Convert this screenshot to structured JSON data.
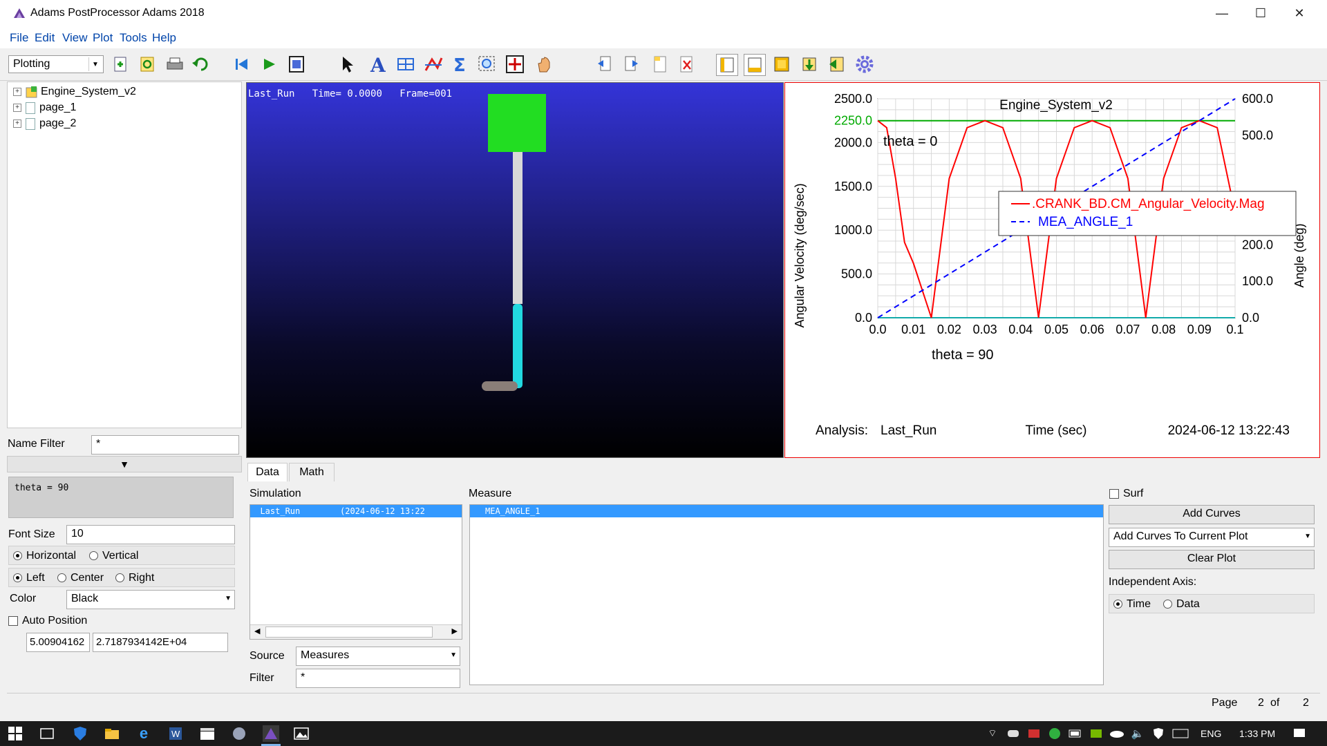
{
  "window": {
    "title": "Adams PostProcessor Adams 2018",
    "minimize": "—",
    "maximize": "☐",
    "close": "✕"
  },
  "menu": [
    "File",
    "Edit",
    "View",
    "Plot",
    "Tools",
    "Help"
  ],
  "toolbar": {
    "mode": "Plotting"
  },
  "tree": [
    {
      "label": "Engine_System_v2",
      "icon": "model-icon"
    },
    {
      "label": "page_1",
      "icon": "page-icon"
    },
    {
      "label": "page_2",
      "icon": "page-icon"
    }
  ],
  "left": {
    "name_filter_label": "Name Filter",
    "name_filter_value": "*",
    "text_content": "theta = 90",
    "font_size_label": "Font Size",
    "font_size_value": "10",
    "orient_horizontal": "Horizontal",
    "orient_vertical": "Vertical",
    "align_left": "Left",
    "align_center": "Center",
    "align_right": "Right",
    "color_label": "Color",
    "color_value": "Black",
    "auto_position_label": "Auto Position",
    "pos_x": "5.00904162",
    "pos_y": "2.7187934142E+04"
  },
  "viewport": {
    "run": "Last_Run",
    "time_label": "Time=",
    "time": "0.0000",
    "frame_label": "Frame=001"
  },
  "chart_data": {
    "type": "line",
    "title": "Engine_System_v2",
    "xlabel": "Time (sec)",
    "ylabel": "Angular Velocity (deg/sec)",
    "y2label": "Angle (deg)",
    "xlim": [
      0.0,
      0.1
    ],
    "ylim": [
      0.0,
      2500.0
    ],
    "y2lim": [
      0.0,
      600.0
    ],
    "x_ticks": [
      "0.0",
      "0.01",
      "0.02",
      "0.03",
      "0.04",
      "0.05",
      "0.06",
      "0.07",
      "0.08",
      "0.09",
      "0.1"
    ],
    "y_ticks": [
      "0.0",
      "500.0",
      "1000.0",
      "1500.0",
      "2000.0",
      "2500.0"
    ],
    "y2_ticks": [
      "0.0",
      "100.0",
      "200.0",
      "300.0",
      "400.0",
      "500.0",
      "600.0"
    ],
    "grid": true,
    "series": [
      {
        "name": ".CRANK_BD.CM_Angular_Velocity.Mag",
        "color": "#ff0000",
        "style": "solid",
        "axis": "left",
        "x": [
          0.0,
          0.0025,
          0.005,
          0.0075,
          0.01,
          0.015,
          0.02,
          0.025,
          0.03,
          0.035,
          0.04,
          0.045,
          0.05,
          0.055,
          0.06,
          0.065,
          0.07,
          0.075,
          0.08,
          0.085,
          0.09,
          0.095,
          0.1
        ],
        "values": [
          2250,
          2170,
          1590,
          860,
          620,
          0,
          1590,
          2170,
          2250,
          2170,
          1590,
          0,
          1590,
          2170,
          2250,
          2170,
          1590,
          0,
          1590,
          2170,
          2250,
          2170,
          1200
        ]
      },
      {
        "name": "MEA_ANGLE_1",
        "color": "#0000ff",
        "style": "dashed",
        "axis": "right",
        "x": [
          0.0,
          0.1
        ],
        "values": [
          0.0,
          600.0
        ]
      }
    ],
    "hline": {
      "value": 2250.0,
      "label": "2250.0",
      "color": "#00aa00"
    },
    "annotations": [
      "theta = 0",
      "theta = 90"
    ],
    "legend_position": "top-right",
    "footer": {
      "analysis_label": "Analysis:",
      "analysis": "Last_Run",
      "timestamp": "2024-06-12 13:22:43"
    }
  },
  "lower": {
    "tabs": [
      "Data",
      "Math"
    ],
    "simulation_label": "Simulation",
    "simulation_items": [
      {
        "name": "Last_Run",
        "date": "(2024-06-12 13:22"
      }
    ],
    "measure_label": "Measure",
    "measure_items": [
      "MEA_ANGLE_1"
    ],
    "source_label": "Source",
    "source_value": "Measures",
    "filter_label": "Filter",
    "filter_value": "*",
    "surf_label": "Surf",
    "add_curves": "Add Curves",
    "add_mode": "Add Curves To Current Plot",
    "clear_plot": "Clear Plot",
    "indep_label": "Independent Axis:",
    "indep_time": "Time",
    "indep_data": "Data"
  },
  "status": {
    "page_label": "Page",
    "page_num": "2",
    "of_label": "of",
    "page_total": "2"
  },
  "taskbar": {
    "lang": "ENG",
    "time": "1:33 PM"
  },
  "colors": {
    "accent": "#3399ff",
    "curve": "#ff0000",
    "measure": "#0000ff",
    "limit": "#00aa00"
  }
}
